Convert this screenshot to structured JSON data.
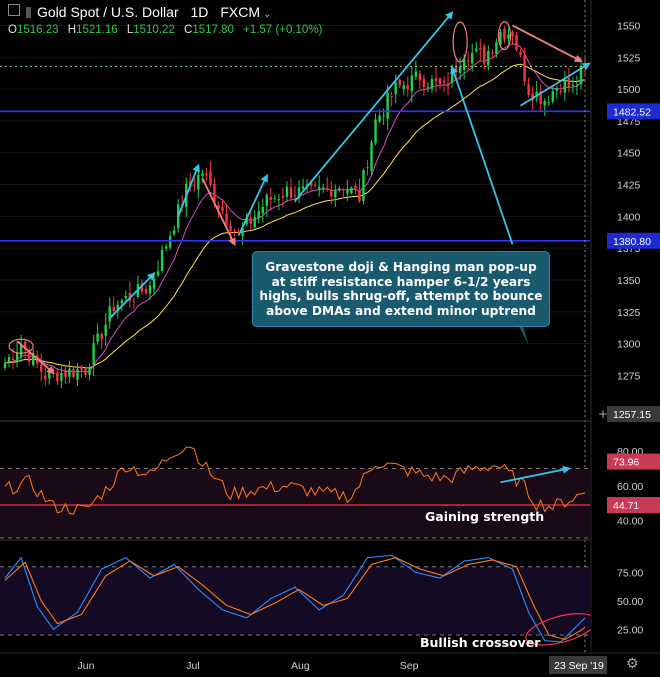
{
  "header": {
    "symbol": "Gold Spot / U.S. Dollar",
    "interval": "1D",
    "source": "FXCM",
    "open_label": "O",
    "open": "1516.23",
    "high_label": "H",
    "high": "1521.16",
    "low_label": "L",
    "low": "1510.22",
    "close_label": "C",
    "close": "1517.80",
    "change": "+1.57 (+0.10%)"
  },
  "annotations": {
    "callout": "Gravestone doji & Hanging man pop-up at stiff resistance hamper 6-1/2 years highs, bulls shrug-off, attempt to bounce above DMAs and extend minor uptrend",
    "rsi_note": "Gaining strength",
    "stoch_note": "Bullish crossover"
  },
  "colors": {
    "background": "#000000",
    "up": "#1fd14a",
    "down": "#f23645",
    "ema_fast": "#d946c8",
    "ema_slow": "#ffe14d",
    "rsi_line": "#ff7a1a",
    "stoch_k": "#2f8cff",
    "stoch_d": "#ff7a1a",
    "arrow_up": "#34c6e8",
    "arrow_down": "#f08080",
    "level_line": "#2c36ff",
    "badge_blue": "#1d2bd1",
    "badge_red": "#c83a55",
    "badge_dark": "#3a3a3a"
  },
  "chart_data": [
    {
      "type": "candlestick",
      "title": "Gold Spot / U.S. Dollar 1D FXCM",
      "price_axis": {
        "min": 1240,
        "max": 1570,
        "ticks": [
          1275,
          1300,
          1325,
          1350,
          1375,
          1400,
          1425,
          1450,
          1475,
          1500,
          1525,
          1550
        ]
      },
      "time_axis": {
        "ticks": [
          "Jun",
          "Jul",
          "Aug",
          "Sep"
        ],
        "cursor_label": "23 Sep '19"
      },
      "price_labels": [
        "1482.52",
        "1380.80",
        "1257.15"
      ],
      "levels": [
        1482.52,
        1380.8
      ],
      "current_price": 1517.8,
      "key_points": [
        {
          "bar": 0,
          "close": 1285
        },
        {
          "bar": 4,
          "close": 1300
        },
        {
          "bar": 10,
          "close": 1275
        },
        {
          "bar": 20,
          "close": 1280
        },
        {
          "bar": 27,
          "close": 1330
        },
        {
          "bar": 36,
          "close": 1345
        },
        {
          "bar": 45,
          "close": 1420
        },
        {
          "bar": 49,
          "close": 1435
        },
        {
          "bar": 53,
          "close": 1410
        },
        {
          "bar": 58,
          "close": 1385
        },
        {
          "bar": 65,
          "close": 1412
        },
        {
          "bar": 70,
          "close": 1420
        },
        {
          "bar": 76,
          "close": 1418
        },
        {
          "bar": 84,
          "close": 1425
        },
        {
          "bar": 88,
          "close": 1415
        },
        {
          "bar": 92,
          "close": 1475
        },
        {
          "bar": 97,
          "close": 1500
        },
        {
          "bar": 103,
          "close": 1510
        },
        {
          "bar": 109,
          "close": 1500
        },
        {
          "bar": 114,
          "close": 1530
        },
        {
          "bar": 119,
          "close": 1525
        },
        {
          "bar": 123,
          "close": 1545
        },
        {
          "bar": 126,
          "close": 1545
        },
        {
          "bar": 130,
          "close": 1500
        },
        {
          "bar": 134,
          "close": 1492
        },
        {
          "bar": 138,
          "close": 1505
        },
        {
          "bar": 141,
          "close": 1500
        },
        {
          "bar": 144,
          "close": 1517.8
        }
      ]
    },
    {
      "type": "line",
      "name": "RSI",
      "y_ticks": [
        40,
        60,
        80
      ],
      "range": [
        30,
        95
      ],
      "levels": [
        70,
        30
      ],
      "labels": [
        "73.96",
        "44.71"
      ],
      "key_points": [
        {
          "bar": 0,
          "value": 58
        },
        {
          "bar": 6,
          "value": 62
        },
        {
          "bar": 12,
          "value": 48
        },
        {
          "bar": 20,
          "value": 46
        },
        {
          "bar": 26,
          "value": 60
        },
        {
          "bar": 30,
          "value": 72
        },
        {
          "bar": 36,
          "value": 66
        },
        {
          "bar": 42,
          "value": 80
        },
        {
          "bar": 46,
          "value": 84
        },
        {
          "bar": 50,
          "value": 70
        },
        {
          "bar": 56,
          "value": 55
        },
        {
          "bar": 62,
          "value": 58
        },
        {
          "bar": 70,
          "value": 60
        },
        {
          "bar": 78,
          "value": 56
        },
        {
          "bar": 86,
          "value": 54
        },
        {
          "bar": 92,
          "value": 74
        },
        {
          "bar": 98,
          "value": 70
        },
        {
          "bar": 104,
          "value": 66
        },
        {
          "bar": 110,
          "value": 64
        },
        {
          "bar": 116,
          "value": 70
        },
        {
          "bar": 122,
          "value": 72
        },
        {
          "bar": 128,
          "value": 62
        },
        {
          "bar": 132,
          "value": 50
        },
        {
          "bar": 136,
          "value": 48
        },
        {
          "bar": 140,
          "value": 52
        },
        {
          "bar": 144,
          "value": 56
        }
      ]
    },
    {
      "type": "line",
      "name": "Stochastic",
      "y_ticks": [
        25,
        50,
        75
      ],
      "range": [
        5,
        100
      ],
      "levels": [
        80,
        20
      ],
      "series": [
        {
          "name": "%K",
          "key_points": [
            {
              "bar": 0,
              "value": 70
            },
            {
              "bar": 4,
              "value": 88
            },
            {
              "bar": 8,
              "value": 45
            },
            {
              "bar": 12,
              "value": 25
            },
            {
              "bar": 18,
              "value": 40
            },
            {
              "bar": 24,
              "value": 78
            },
            {
              "bar": 30,
              "value": 88
            },
            {
              "bar": 36,
              "value": 70
            },
            {
              "bar": 42,
              "value": 82
            },
            {
              "bar": 48,
              "value": 60
            },
            {
              "bar": 54,
              "value": 42
            },
            {
              "bar": 60,
              "value": 35
            },
            {
              "bar": 66,
              "value": 52
            },
            {
              "bar": 72,
              "value": 62
            },
            {
              "bar": 78,
              "value": 42
            },
            {
              "bar": 84,
              "value": 55
            },
            {
              "bar": 90,
              "value": 88
            },
            {
              "bar": 96,
              "value": 90
            },
            {
              "bar": 102,
              "value": 75
            },
            {
              "bar": 108,
              "value": 70
            },
            {
              "bar": 114,
              "value": 85
            },
            {
              "bar": 120,
              "value": 88
            },
            {
              "bar": 126,
              "value": 78
            },
            {
              "bar": 130,
              "value": 40
            },
            {
              "bar": 134,
              "value": 15
            },
            {
              "bar": 138,
              "value": 14
            },
            {
              "bar": 142,
              "value": 28
            },
            {
              "bar": 144,
              "value": 35
            }
          ]
        },
        {
          "name": "%D",
          "key_points": [
            {
              "bar": 0,
              "value": 68
            },
            {
              "bar": 5,
              "value": 84
            },
            {
              "bar": 9,
              "value": 50
            },
            {
              "bar": 13,
              "value": 30
            },
            {
              "bar": 19,
              "value": 38
            },
            {
              "bar": 25,
              "value": 72
            },
            {
              "bar": 31,
              "value": 85
            },
            {
              "bar": 37,
              "value": 72
            },
            {
              "bar": 43,
              "value": 80
            },
            {
              "bar": 49,
              "value": 64
            },
            {
              "bar": 55,
              "value": 46
            },
            {
              "bar": 61,
              "value": 38
            },
            {
              "bar": 67,
              "value": 48
            },
            {
              "bar": 73,
              "value": 60
            },
            {
              "bar": 79,
              "value": 46
            },
            {
              "bar": 85,
              "value": 52
            },
            {
              "bar": 91,
              "value": 82
            },
            {
              "bar": 97,
              "value": 88
            },
            {
              "bar": 103,
              "value": 78
            },
            {
              "bar": 109,
              "value": 72
            },
            {
              "bar": 115,
              "value": 82
            },
            {
              "bar": 121,
              "value": 86
            },
            {
              "bar": 127,
              "value": 80
            },
            {
              "bar": 131,
              "value": 48
            },
            {
              "bar": 135,
              "value": 20
            },
            {
              "bar": 139,
              "value": 16
            },
            {
              "bar": 143,
              "value": 24
            },
            {
              "bar": 144,
              "value": 27
            }
          ]
        }
      ]
    }
  ]
}
